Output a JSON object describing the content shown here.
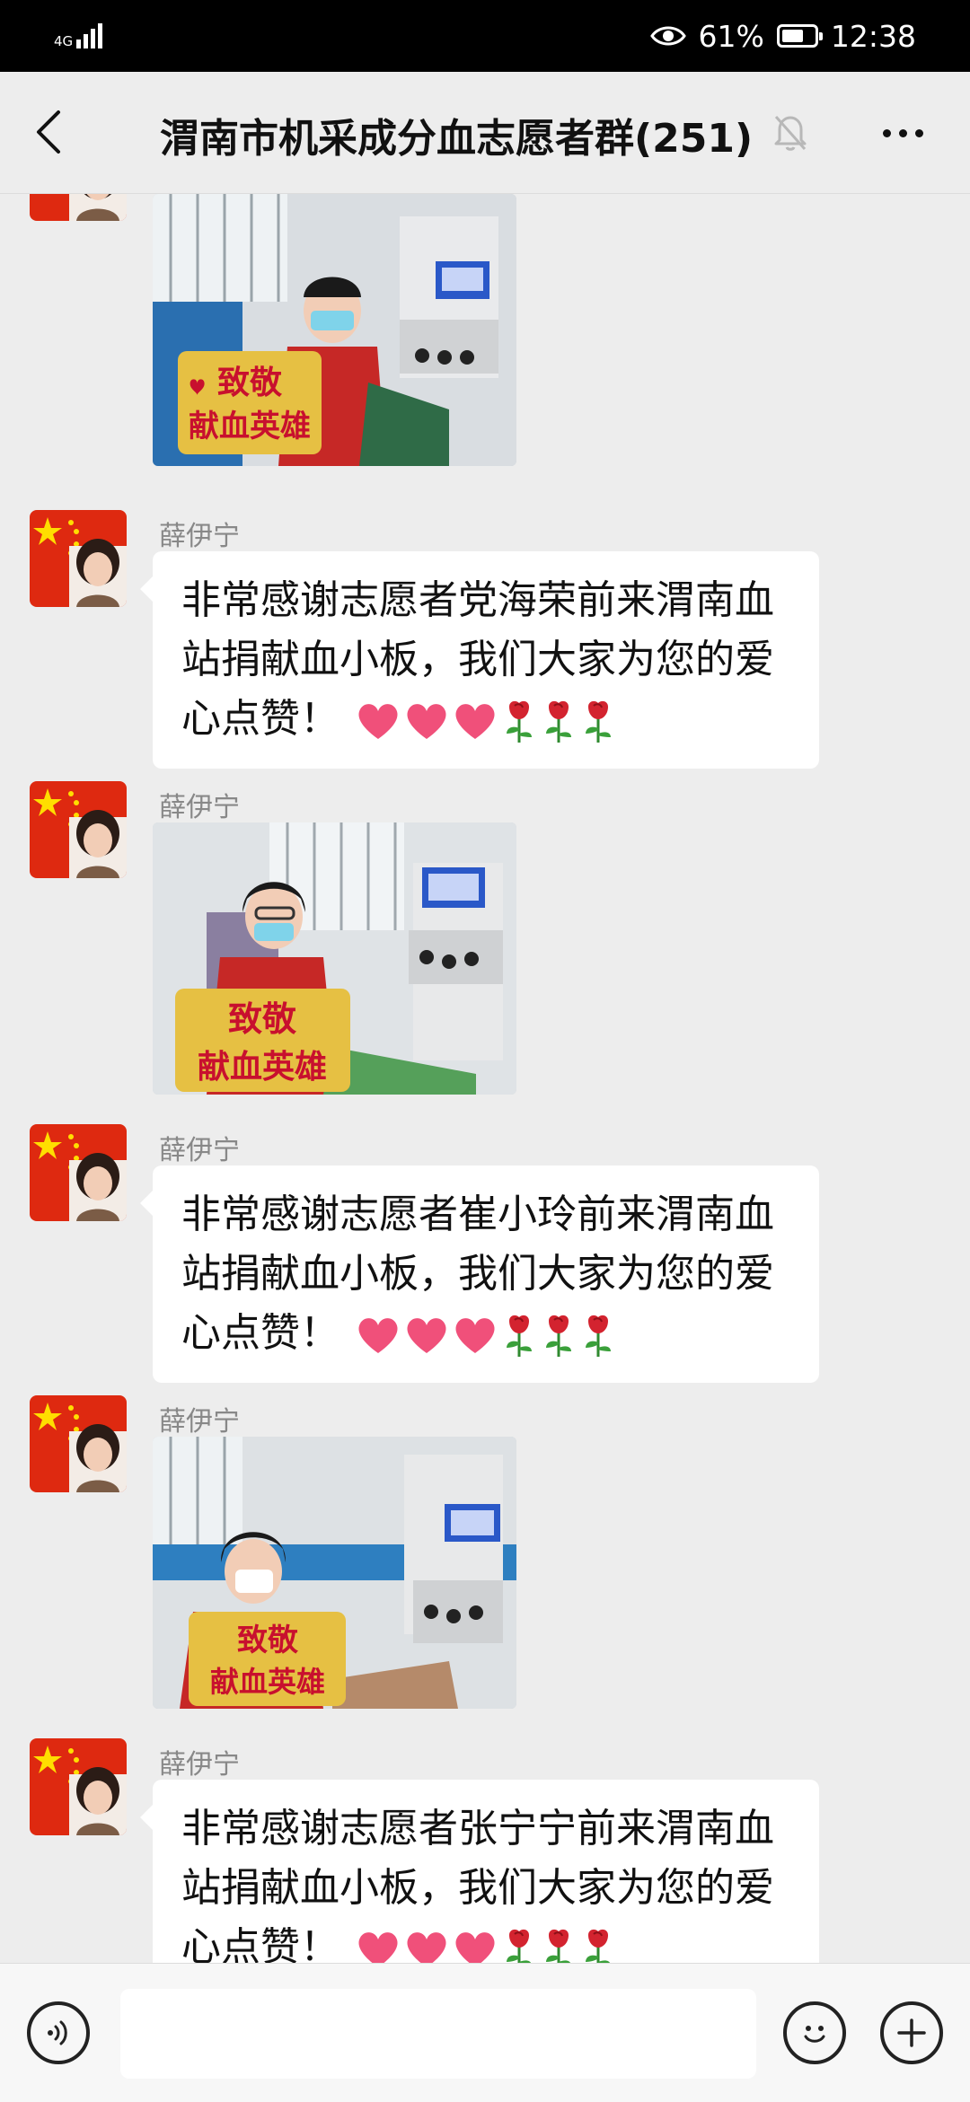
{
  "status_bar": {
    "network": "4G",
    "battery": "61%",
    "battery_level": 0.61,
    "time": "12:38"
  },
  "header": {
    "title": "渭南市机采成分血志愿者群(251)"
  },
  "messages": [
    {
      "sender": "薛伊宁",
      "type": "image",
      "image_sign": [
        "致敬",
        "献血英雄"
      ]
    },
    {
      "sender": "薛伊宁",
      "type": "text",
      "lines": [
        "非常感谢志愿者党海荣前来渭南血",
        "站捐献血小板，我们大家为您的爱",
        "心点赞！"
      ]
    },
    {
      "sender": "薛伊宁",
      "type": "image",
      "image_sign": [
        "致敬",
        "献血英雄"
      ]
    },
    {
      "sender": "薛伊宁",
      "type": "text",
      "lines": [
        "非常感谢志愿者崔小玲前来渭南血",
        "站捐献血小板，我们大家为您的爱",
        "心点赞！"
      ]
    },
    {
      "sender": "薛伊宁",
      "type": "image",
      "image_sign": [
        "致敬",
        "献血英雄"
      ]
    },
    {
      "sender": "薛伊宁",
      "type": "text",
      "lines": [
        "非常感谢志愿者张宁宁前来渭南血",
        "站捐献血小板，我们大家为您的爱",
        "心点赞！"
      ]
    }
  ],
  "emoji": {
    "hearts": [
      "heart-icon",
      "heart-icon",
      "heart-icon"
    ],
    "roses": [
      "rose-icon",
      "rose-icon",
      "rose-icon"
    ]
  },
  "colors": {
    "background": "#ededed",
    "bubble": "#ffffff",
    "heart": "#f0507a",
    "rose": "#d3232f",
    "sign": "#e6c043",
    "sign_text": "#c8102e",
    "flag_red": "#de2910",
    "flag_star": "#ffde00"
  }
}
